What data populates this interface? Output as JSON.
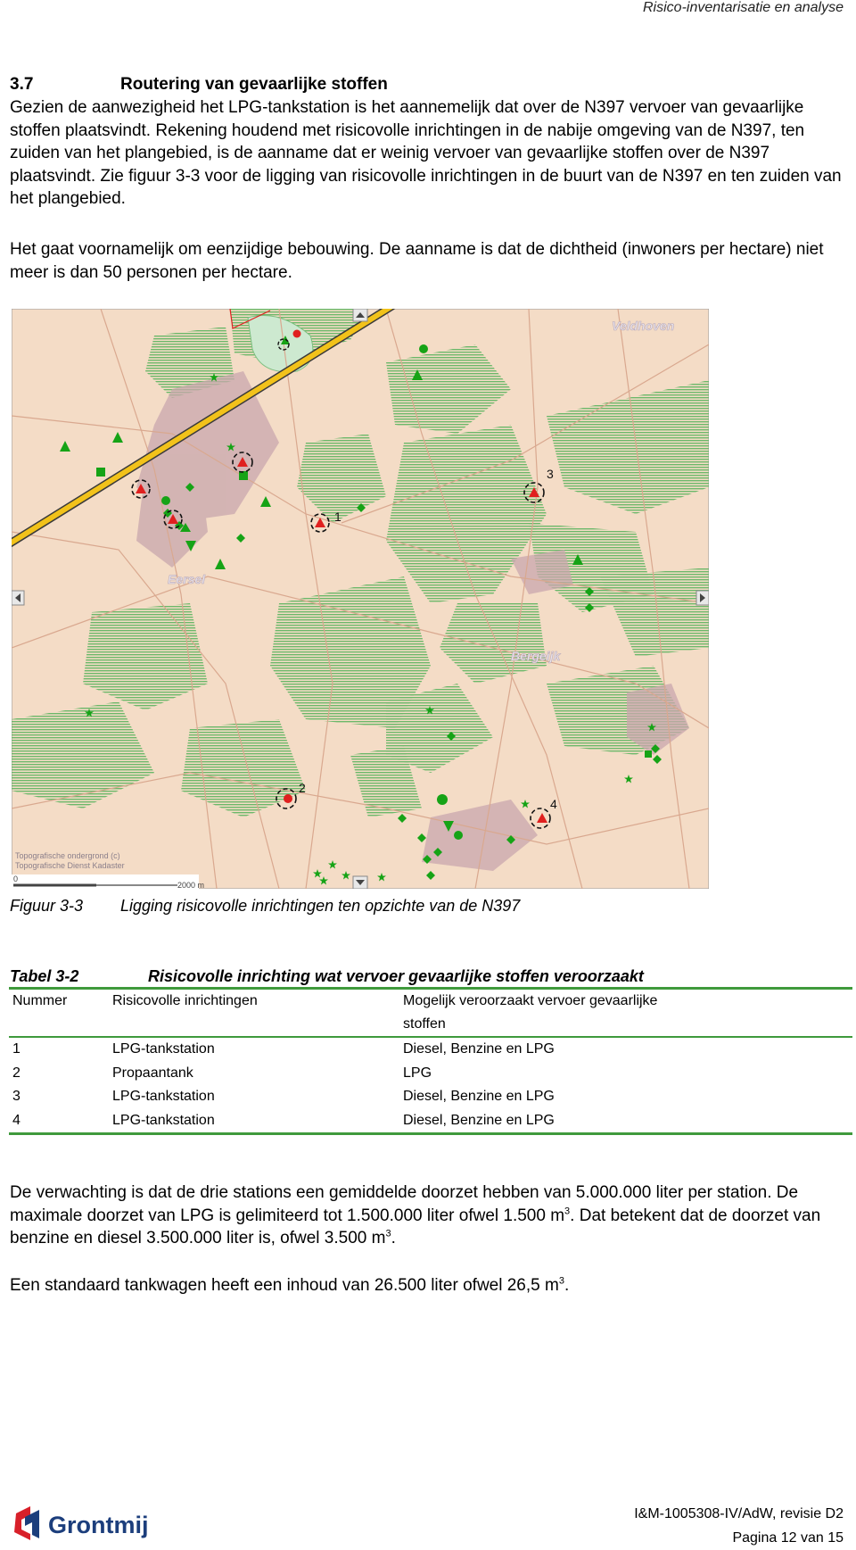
{
  "header": {
    "title": "Risico-inventarisatie en analyse"
  },
  "section": {
    "number": "3.7",
    "title": "Routering van gevaarlijke stoffen",
    "paragraph1": "Gezien de aanwezigheid het LPG-tankstation is het aannemelijk dat over de N397 vervoer van gevaarlijke stoffen plaatsvindt. Rekening houdend met risicovolle inrichtingen in de nabije omgeving van de N397, ten zuiden van het plangebied, is de aanname dat er weinig vervoer van gevaarlijke stoffen over de N397 plaatsvindt. Zie figuur 3-3 voor de ligging van risicovolle inrichtingen in de buurt van de N397 en ten zuiden van het plangebied.",
    "paragraph2": "Het gaat voornamelijk om eenzijdige bebouwing. De aanname is dat de dichtheid (inwoners per hectare) niet meer is dan 50 personen per hectare."
  },
  "map": {
    "place_labels": [
      "Veldhoven",
      "Eersel",
      "Bergeijk"
    ],
    "marker_labels": [
      "1",
      "2",
      "3",
      "4"
    ],
    "copyright_line1": "Topografische ondergrond (c)",
    "copyright_line2": "Topografische Dienst Kadaster",
    "scale_start": "0",
    "scale_end": "2000 m",
    "colors": {
      "background": "#f4dcc6",
      "road": "#f2c21a",
      "forest": "#6cb86a",
      "marker": "#16a316",
      "risk": "#e0201f"
    }
  },
  "figure": {
    "label": "Figuur 3-3",
    "caption": "Ligging risicovolle inrichtingen ten opzichte van de N397"
  },
  "table": {
    "label": "Tabel 3-2",
    "title": "Risicovolle inrichting wat vervoer gevaarlijke stoffen veroorzaakt",
    "headers": [
      "Nummer",
      "Risicovolle inrichtingen",
      "Mogelijk veroorzaakt vervoer gevaarlijke",
      "stoffen"
    ],
    "rows": [
      [
        "1",
        "LPG-tankstation",
        "Diesel, Benzine en LPG"
      ],
      [
        "2",
        "Propaantank",
        "LPG"
      ],
      [
        "3",
        "LPG-tankstation",
        "Diesel, Benzine en LPG"
      ],
      [
        "4",
        "LPG-tankstation",
        "Diesel, Benzine en LPG"
      ]
    ]
  },
  "paragraph3": {
    "part1": "De verwachting is dat de drie stations een gemiddelde doorzet hebben van 5.000.000 liter per station. De maximale doorzet van LPG is gelimiteerd tot 1.500.000 liter ofwel 1.500 m",
    "sup1": "3",
    "part2": ". Dat betekent dat de doorzet van benzine en diesel 3.500.000 liter is, ofwel 3.500 m",
    "sup2": "3",
    "part3": "."
  },
  "paragraph4": {
    "part1": "Een standaard tankwagen heeft een inhoud van 26.500 liter ofwel 26,5 m",
    "sup1": "3",
    "part2": "."
  },
  "footer": {
    "logo_text": "Grontmij",
    "reference": "I&M-1005308-IV/AdW, revisie D2",
    "page": "Pagina 12 van 15"
  }
}
